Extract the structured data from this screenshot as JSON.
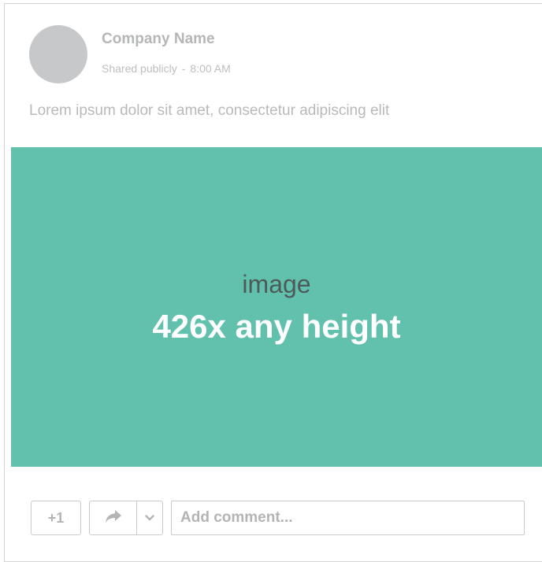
{
  "post": {
    "author": "Company Name",
    "visibility": "Shared publicly",
    "separator": "-",
    "time": "8:00 AM",
    "text": "Lorem ipsum dolor sit amet, consectetur adipiscing elit",
    "image": {
      "label": "image",
      "size_text": "426x any height",
      "background": "#61c1ad"
    }
  },
  "actions": {
    "plus_one_label": "+1",
    "share_icon": "share-arrow-icon",
    "share_menu_icon": "chevron-down-icon",
    "comment_placeholder": "Add comment..."
  },
  "colors": {
    "avatar": "#c7c8ca",
    "text_muted": "#b5b6b8",
    "border": "#c9cacc"
  }
}
